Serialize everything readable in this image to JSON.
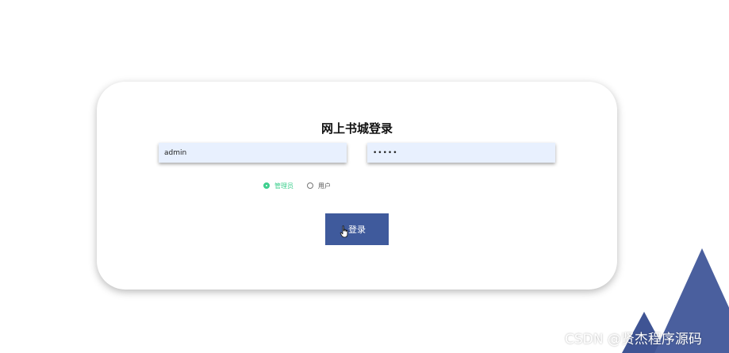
{
  "login": {
    "title": "网上书城登录",
    "username_value": "admin",
    "password_value": "•••••",
    "roles": [
      {
        "label": "管理员",
        "selected": true
      },
      {
        "label": "用户",
        "selected": false
      }
    ],
    "submit_label": "登录"
  },
  "watermark": "CSDN @贤杰程序源码",
  "colors": {
    "accent_green": "#3ecf8e",
    "button_blue": "#3f5a9c",
    "mountain_blue": "#4a5f9e",
    "input_bg": "#e8f0fe"
  },
  "icons": {
    "cursor": "hand-pointer-icon",
    "decor": "mountain-icon"
  }
}
